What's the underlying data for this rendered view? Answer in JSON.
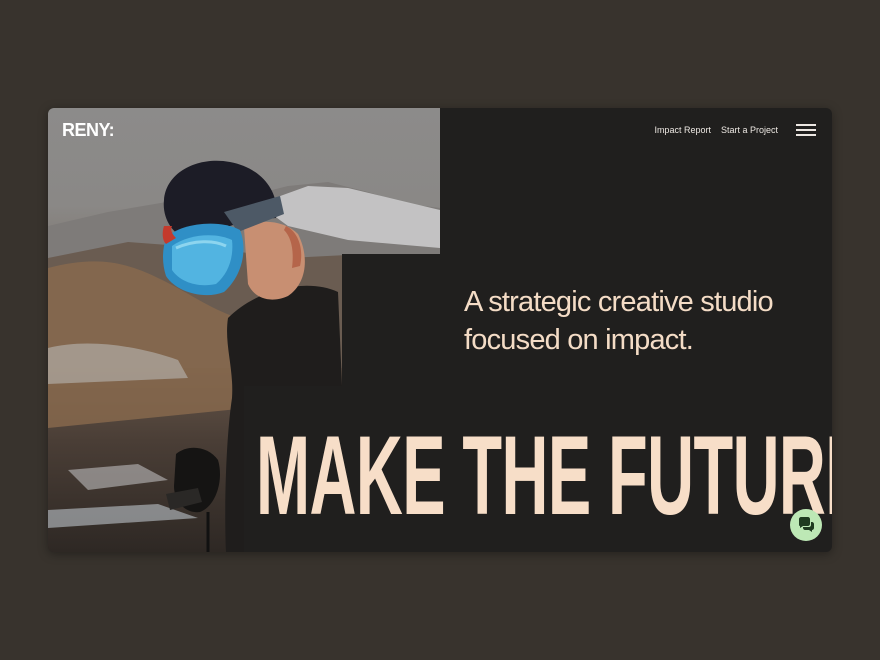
{
  "brand": {
    "logo_text": "RENY:"
  },
  "nav": {
    "links": [
      "Impact Report",
      "Start a Project"
    ],
    "menu_icon": "hamburger-menu-icon"
  },
  "hero": {
    "tagline": "A strategic creative studio focused on impact.",
    "headline": "MAKE THE FUTURE",
    "image_subject": "snowboarder with mirrored goggles"
  },
  "chat": {
    "icon": "chat-bubble-icon",
    "color": "#bde8b5"
  },
  "colors": {
    "page_bg": "#38332d",
    "panel_bg": "#201f1e",
    "accent_text": "#f4dcc6"
  }
}
